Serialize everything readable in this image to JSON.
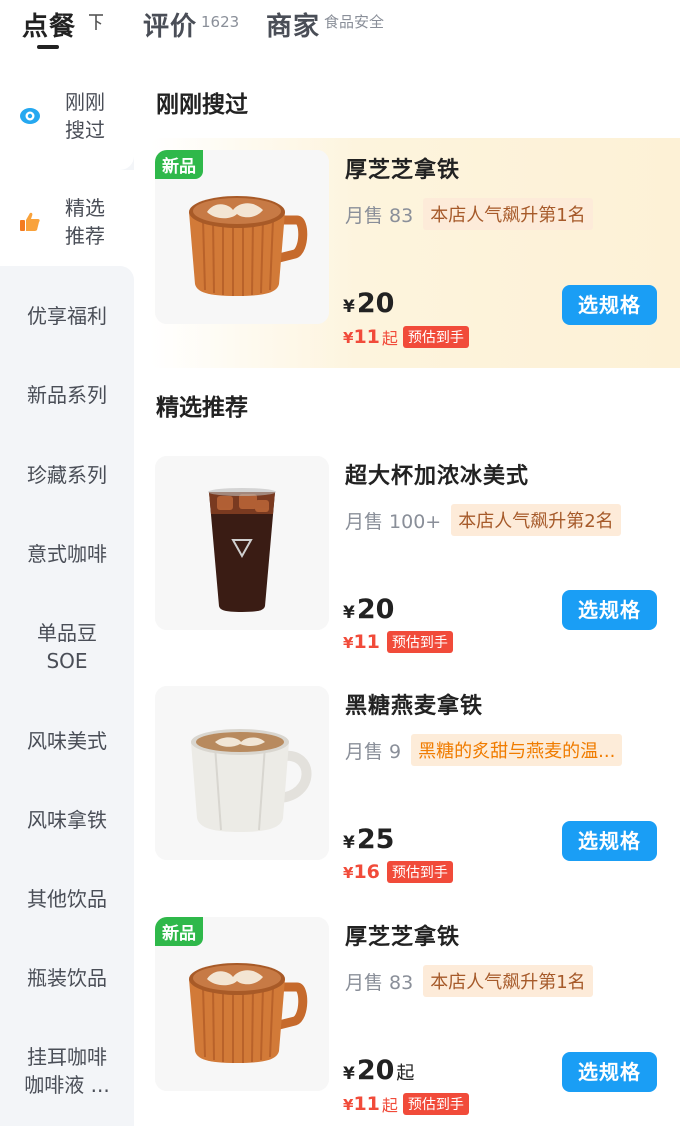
{
  "tabs": [
    {
      "label": "点餐",
      "sub": ""
    },
    {
      "label": "评价",
      "sub": "1623"
    },
    {
      "label": "商家",
      "sub": "食品安全"
    }
  ],
  "sort_icon_glyph": "下",
  "sidebar": {
    "items": [
      {
        "line1": "刚刚",
        "line2": "搜过",
        "icon": "eye-icon"
      },
      {
        "line1": "精选",
        "line2": "推荐",
        "icon": "thumbs-up-icon"
      },
      {
        "label": "优享福利"
      },
      {
        "label": "新品系列"
      },
      {
        "label": "珍藏系列"
      },
      {
        "label": "意式咖啡"
      },
      {
        "line1": "单品豆",
        "line2": "SOE"
      },
      {
        "label": "风味美式"
      },
      {
        "label": "风味拿铁"
      },
      {
        "label": "其他饮品"
      },
      {
        "label": "瓶装饮品"
      },
      {
        "line1": "挂耳咖啡",
        "line2": "咖啡液 ..."
      }
    ]
  },
  "sections": [
    {
      "title": "刚刚搜过"
    },
    {
      "title": "精选推荐"
    }
  ],
  "products": [
    {
      "badge": "新品",
      "name": "厚芝芝拿铁",
      "sales": "月售 83",
      "tag": "本店人气飙升第1名",
      "yen": "¥",
      "price": "20",
      "price_suffix": "",
      "est_yen": "¥",
      "est_price": "11",
      "est_suffix": "起",
      "est_label": "预估到手",
      "button": "选规格",
      "image": "orange-cup-latte"
    },
    {
      "badge": "",
      "name": "超大杯加浓冰美式",
      "sales": "月售 100+",
      "tag": "本店人气飙升第2名",
      "yen": "¥",
      "price": "20",
      "price_suffix": "",
      "est_yen": "¥",
      "est_price": "11",
      "est_suffix": "",
      "est_label": "预估到手",
      "button": "选规格",
      "image": "iced-americano"
    },
    {
      "badge": "",
      "name": "黑糖燕麦拿铁",
      "sales": "月售 9",
      "tag": "黑糖的炙甜与燕麦的温...",
      "yen": "¥",
      "price": "25",
      "price_suffix": "",
      "est_yen": "¥",
      "est_price": "16",
      "est_suffix": "",
      "est_label": "预估到手",
      "button": "选规格",
      "image": "white-mug-latte"
    },
    {
      "badge": "新品",
      "name": "厚芝芝拿铁",
      "sales": "月售 83",
      "tag": "本店人气飙升第1名",
      "yen": "¥",
      "price": "20",
      "price_suffix": "起",
      "est_yen": "¥",
      "est_price": "11",
      "est_suffix": "起",
      "est_label": "预估到手",
      "button": "选规格",
      "image": "orange-cup-latte"
    }
  ],
  "colors": {
    "accent": "#1a9ef5",
    "new_badge": "#2fb84a",
    "price_red": "#f14b3a",
    "highlight_bg": "#fdf1d6"
  }
}
